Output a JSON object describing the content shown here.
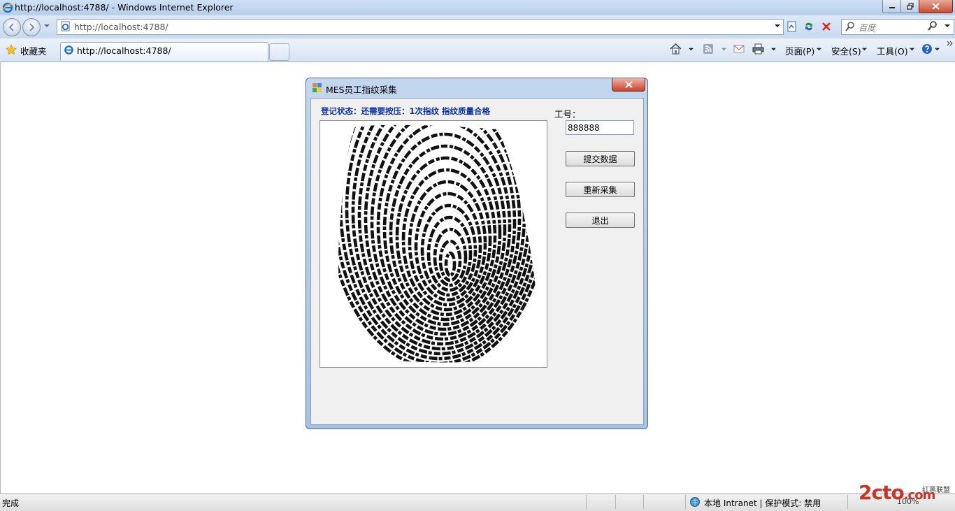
{
  "window": {
    "title": "http://localhost:4788/ - Windows Internet Explorer"
  },
  "address_bar": {
    "url": "http://localhost:4788/",
    "search_placeholder": "百度"
  },
  "command_bar": {
    "favorites_label": "收藏夹",
    "tab_label": "http://localhost:4788/",
    "page_menu": "页面(P)",
    "safety_menu": "安全(S)",
    "tools_menu": "工具(O)"
  },
  "dialog": {
    "title": "MES员工指纹采集",
    "status_text": "登记状态：还需要按压：1次指纹 指纹质量合格",
    "employee_no_label": "工号：",
    "employee_no_value": "888888",
    "submit_button": "提交数据",
    "recapture_button": "重新采集",
    "exit_button": "退出"
  },
  "status_bar": {
    "status": "完成",
    "zone": "本地 Intranet | 保护模式: 禁用",
    "zoom": "100%",
    "watermark": "2cto",
    "watermark_suffix": ".com",
    "watermark_sub": "红黑联盟"
  },
  "colors": {
    "status_text": "#0a2fa3",
    "dialog_frame": "#a9c2e2",
    "close_button": "#c84a33"
  }
}
